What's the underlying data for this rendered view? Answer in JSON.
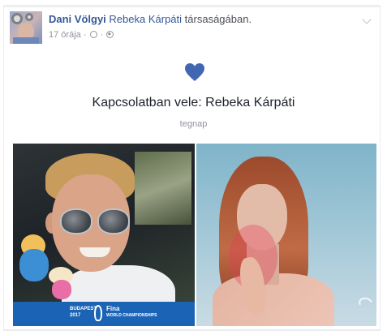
{
  "post": {
    "author": "Dani Völgyi",
    "tagged": "Rebeka Kárpáti",
    "author_suffix": "társaságában.",
    "timestamp": "17 órája",
    "separator_1": "·",
    "separator_2": "·"
  },
  "life_event": {
    "title": "Kapcsolatban vele: Rebeka Kárpáti",
    "date": "tegnap"
  },
  "photo_frame": {
    "city": "BUDAPEST",
    "year": "2017",
    "brand": "Fina",
    "subtitle": "WORLD CHAMPIONSHIPS"
  },
  "colors": {
    "link": "#365899",
    "heart": "#4267b2",
    "banner": "#1a63b5"
  },
  "icons": {
    "privacy": "globe-icon",
    "time": "clock-icon",
    "options": "chevron-down-icon",
    "event": "heart-icon"
  }
}
